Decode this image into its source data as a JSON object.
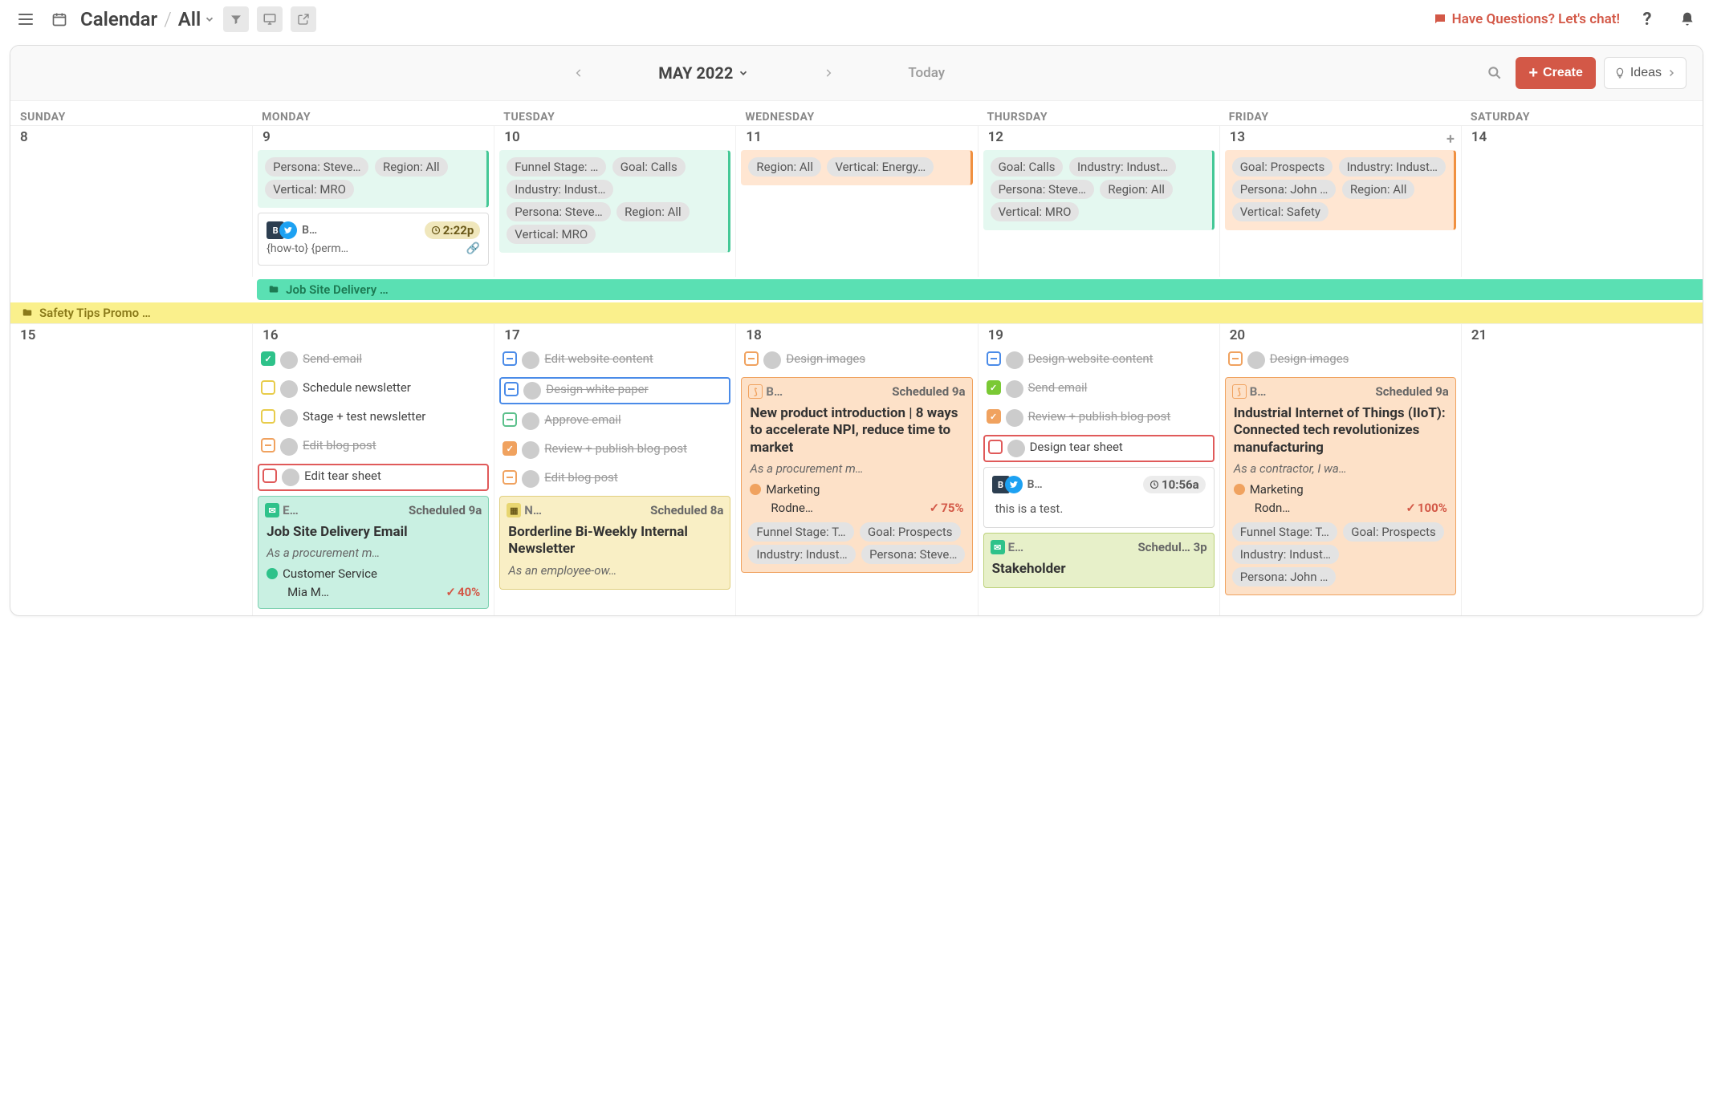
{
  "breadcrumb": {
    "title": "Calendar",
    "view": "All"
  },
  "questions": "Have Questions? Let's chat!",
  "month": "MAY 2022",
  "today": "Today",
  "create": "Create",
  "ideas": "Ideas",
  "dayNames": [
    "SUNDAY",
    "MONDAY",
    "TUESDAY",
    "WEDNESDAY",
    "THURSDAY",
    "FRIDAY",
    "SATURDAY"
  ],
  "week1": {
    "dates": [
      "8",
      "9",
      "10",
      "11",
      "12",
      "13",
      "14"
    ]
  },
  "week2": {
    "dates": [
      "15",
      "16",
      "17",
      "18",
      "19",
      "20",
      "21"
    ]
  },
  "tags": {
    "persona_steve": "Persona: Steve…",
    "region_all": "Region: All",
    "vertical_mro": "Vertical: MRO",
    "funnel_stage": "Funnel Stage: …",
    "goal_calls": "Goal: Calls",
    "industry_indust": "Industry: Indust…",
    "vertical_energy": "Vertical: Energy…",
    "goal_prospects": "Goal: Prospects",
    "persona_john": "Persona: John …",
    "vertical_safety": "Vertical: Safety",
    "funnel_t": "Funnel Stage: T…"
  },
  "social1": {
    "label": "B…",
    "time": "2:22p",
    "text": "{how-to} {perm…"
  },
  "social2": {
    "label": "B…",
    "time": "10:56a",
    "text": "this is a test."
  },
  "bands": {
    "jobsite": "Job Site Delivery …",
    "safety": "Safety Tips Promo …"
  },
  "tasks": {
    "send_email": "Send email",
    "schedule_news": "Schedule newsletter",
    "stage_test": "Stage + test newsletter",
    "edit_blog": "Edit blog post",
    "edit_tear": "Edit tear sheet",
    "edit_website": "Edit website content",
    "design_white": "Design white paper",
    "approve_email": "Approve email",
    "review_publish": "Review + publish blog post",
    "design_images": "Design images",
    "design_website": "Design website content",
    "design_tear": "Design tear sheet"
  },
  "cards": {
    "jobsite": {
      "type": "E…",
      "sched": "Scheduled",
      "time": "9a",
      "title": "Job Site Delivery Email",
      "sub": "As a procurement m…",
      "cat": "Customer Service",
      "owner": "Mia M…",
      "pct": "40%"
    },
    "borderline": {
      "type": "N…",
      "sched": "Scheduled",
      "time": "8a",
      "title": "Borderline Bi-Weekly Internal Newsletter",
      "sub": "As an employee-ow…"
    },
    "npi": {
      "type": "B…",
      "sched": "Scheduled",
      "time": "9a",
      "title": "New product introduction | 8 ways to accelerate NPI, reduce time to market",
      "sub": "As a procurement m…",
      "cat": "Marketing",
      "owner": "Rodne…",
      "pct": "75%"
    },
    "iiot": {
      "type": "B…",
      "sched": "Scheduled",
      "time": "9a",
      "title": "Industrial Internet of Things (IIoT): Connected tech revolutionizes manufacturing",
      "sub": "As a contractor, I wa…",
      "cat": "Marketing",
      "owner": "Rodn…",
      "pct": "100%"
    },
    "stakeholder": {
      "type": "E…",
      "sched": "Schedul…",
      "time": "3p",
      "title": "Stakeholder"
    }
  }
}
